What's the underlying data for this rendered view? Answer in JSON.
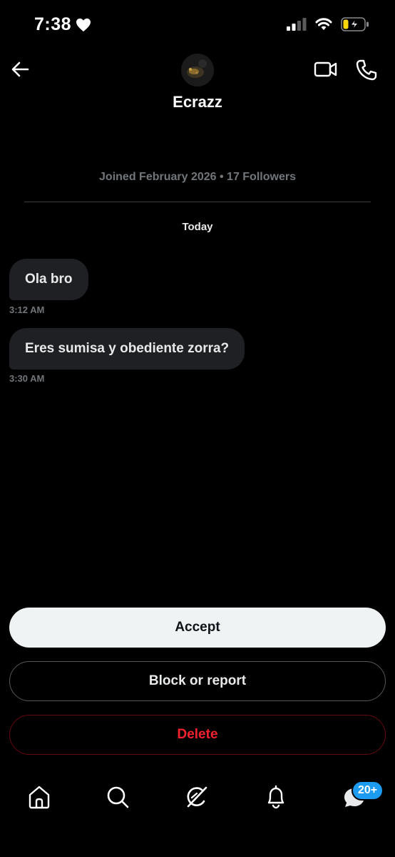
{
  "status_bar": {
    "time": "7:38",
    "heart_icon": "heart-icon",
    "signal_icon": "cellular-signal-icon",
    "wifi_icon": "wifi-icon",
    "battery_icon": "battery-charging-icon"
  },
  "header": {
    "back_icon": "back-arrow-icon",
    "name": "Ecrazz",
    "video_icon": "video-call-icon",
    "phone_icon": "phone-call-icon"
  },
  "profile_meta": "Joined February 2026 • 17 Followers",
  "day_separator": "Today",
  "messages": [
    {
      "text": "Ola bro",
      "time": "3:12 AM"
    },
    {
      "text": "Eres sumisa y obediente zorra?",
      "time": "3:30 AM"
    }
  ],
  "actions": {
    "accept": "Accept",
    "block_or_report": "Block or report",
    "delete": "Delete"
  },
  "tab_bar": {
    "items": [
      "home-icon",
      "search-icon",
      "grok-icon",
      "notifications-icon",
      "messages-icon"
    ],
    "messages_badge": "20+"
  },
  "colors": {
    "background": "#000000",
    "accent_blue": "#1d9bf0",
    "danger_red": "#f4212e",
    "bubble": "#1f2023",
    "muted_text": "#71767b"
  }
}
